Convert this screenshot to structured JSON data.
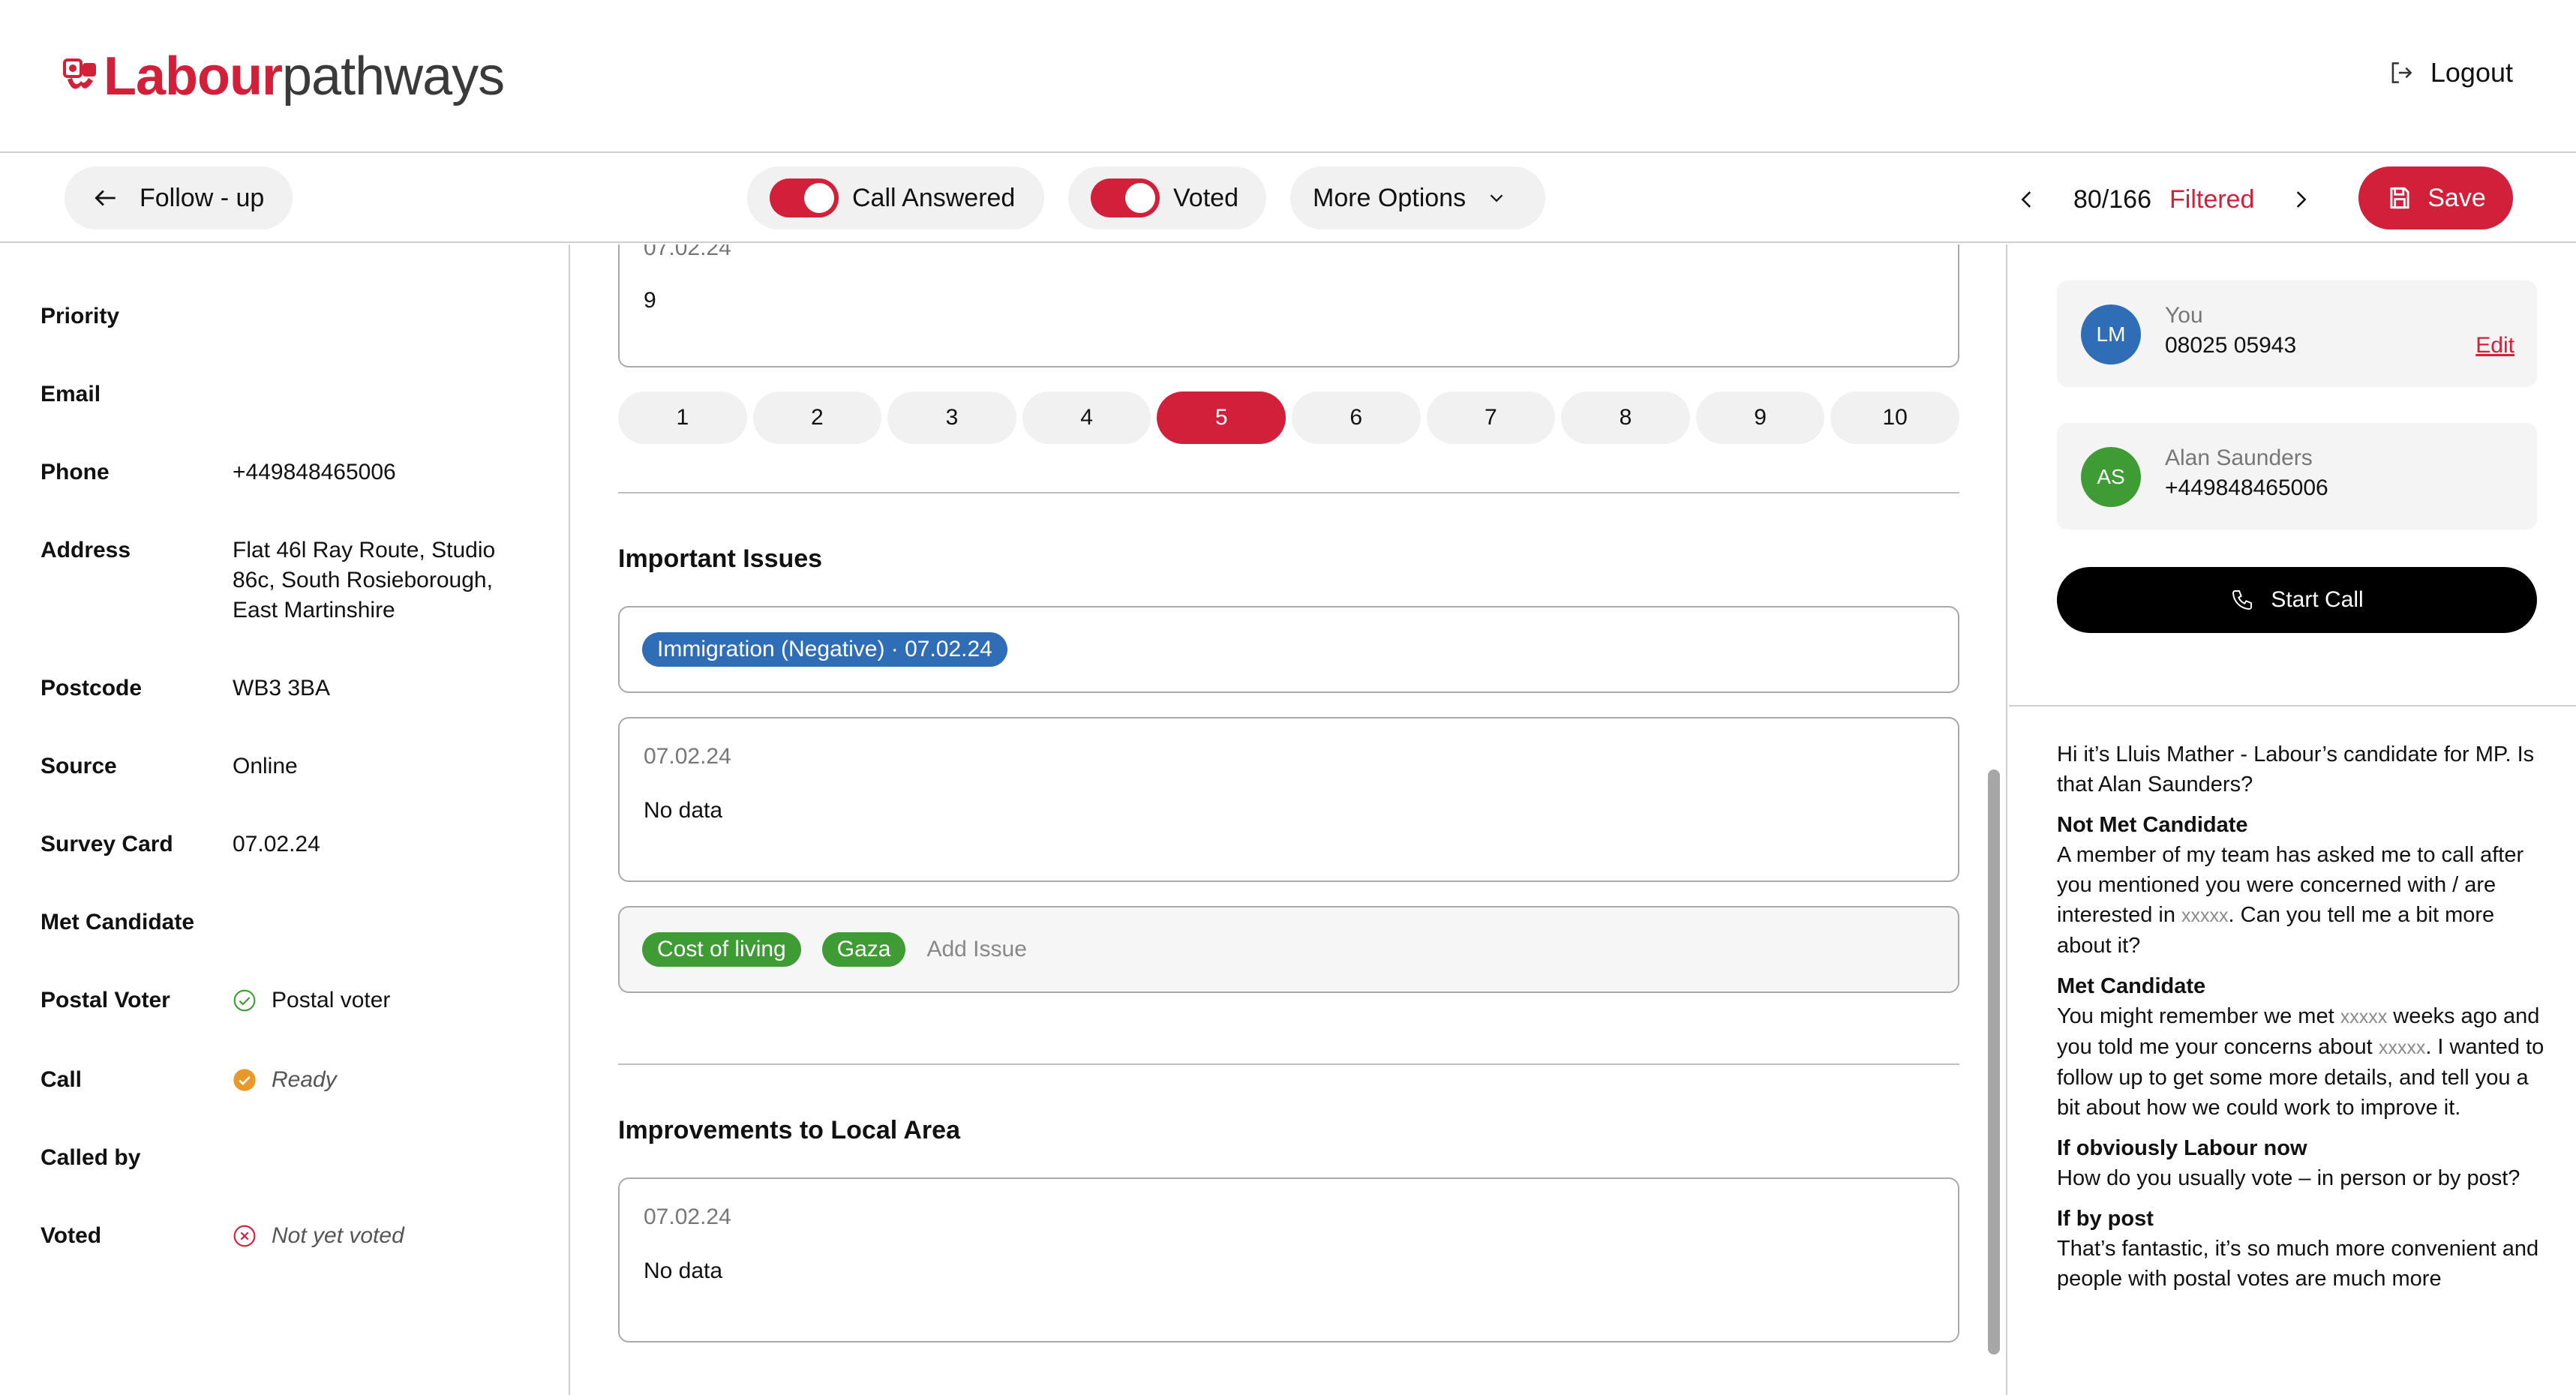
{
  "header": {
    "brand": "Labour",
    "product": "pathways",
    "logout_label": "Logout"
  },
  "toolbar": {
    "back_label": "Follow - up",
    "call_answered_label": "Call Answered",
    "call_answered_on": true,
    "voted_label": "Voted",
    "voted_on": true,
    "more_options_label": "More Options",
    "pager_count": "80/166",
    "pager_filter": "Filtered",
    "save_label": "Save"
  },
  "details": {
    "priority_label": "Priority",
    "email_label": "Email",
    "phone_label": "Phone",
    "phone_value": "+449848465006",
    "address_label": "Address",
    "address_line1": "Flat 46l Ray Route, Studio",
    "address_line2": "86c, South Rosieborough,",
    "address_line3": "East Martinshire",
    "postcode_label": "Postcode",
    "postcode_value": "WB3 3BA",
    "source_label": "Source",
    "source_value": "Online",
    "survey_card_label": "Survey Card",
    "survey_card_value": "07.02.24",
    "met_candidate_label": "Met Candidate",
    "postal_voter_label": "Postal Voter",
    "postal_voter_value": "Postal voter",
    "call_label": "Call",
    "call_value": "Ready",
    "called_by_label": "Called by",
    "voted_label": "Voted",
    "voted_value": "Not yet voted"
  },
  "main": {
    "top_note": {
      "date": "07.02.24",
      "text": "9"
    },
    "scale": [
      "1",
      "2",
      "3",
      "4",
      "5",
      "6",
      "7",
      "8",
      "9",
      "10"
    ],
    "scale_selected": "5",
    "important_issues": {
      "title": "Important Issues",
      "history_tag": "Immigration (Negative) · 07.02.24",
      "note_date": "07.02.24",
      "note_text": "No data",
      "tags": [
        "Cost of living",
        "Gaza"
      ],
      "add_issue_label": "Add Issue"
    },
    "improvements": {
      "title": "Improvements to Local Area",
      "note_date": "07.02.24",
      "note_text": "No data"
    }
  },
  "contacts": {
    "you": {
      "initials": "LM",
      "name": "You",
      "phone": "08025 05943",
      "edit_label": "Edit"
    },
    "voter": {
      "initials": "AS",
      "name": "Alan Saunders",
      "phone": "+449848465006"
    },
    "start_call_label": "Start Call"
  },
  "script": {
    "intro": "Hi it’s Lluis Mather - Labour’s candidate for MP. Is that Alan Saunders?",
    "not_met_heading": "Not Met Candidate",
    "not_met_a": "A member of my team has asked me to call after you mentioned you were concerned with / are interested in ",
    "placeholder": "xxxxx",
    "not_met_b": ". Can you tell me a bit more about it?",
    "met_heading": "Met Candidate",
    "met_a": "You might remember we met ",
    "met_b": " weeks ago and you told me your concerns about ",
    "met_c": ". I wanted to follow up to get some more details, and tell you a bit about how we could work to improve it.",
    "labour_heading": "If obviously Labour now",
    "labour_text": "How do you usually vote – in person or by post?",
    "post_heading": "If by post",
    "post_text": "That’s fantastic, it’s so much more convenient and people with postal votes are much more"
  },
  "colors": {
    "accent": "#d3203a",
    "tag_blue": "#2f6db7",
    "tag_green": "#3f9c35",
    "ready": "#e8992a",
    "postal_check": "#3f9c35"
  }
}
